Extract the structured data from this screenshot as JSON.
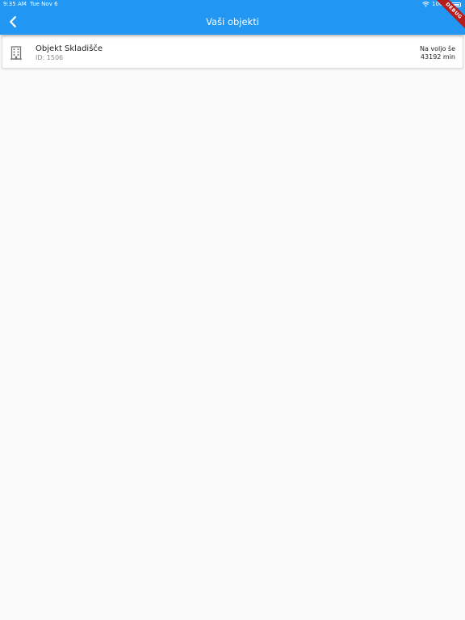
{
  "status_bar": {
    "time": "9:35 AM",
    "date": "Tue Nov 6",
    "battery": "100%",
    "battery_level": 1.0,
    "wifi_icon": "wifi-icon",
    "battery_icon": "battery-icon"
  },
  "app_bar": {
    "title": "Vaši objekti",
    "back_icon": "chevron-left-icon",
    "color": "#2196f3"
  },
  "debug_banner": "DEBUG",
  "objects": [
    {
      "icon": "building-icon",
      "name": "Objekt Skladišče",
      "id_label": "ID: 1506",
      "availability_label": "Na voljo še",
      "availability_value": "43192 min"
    }
  ]
}
